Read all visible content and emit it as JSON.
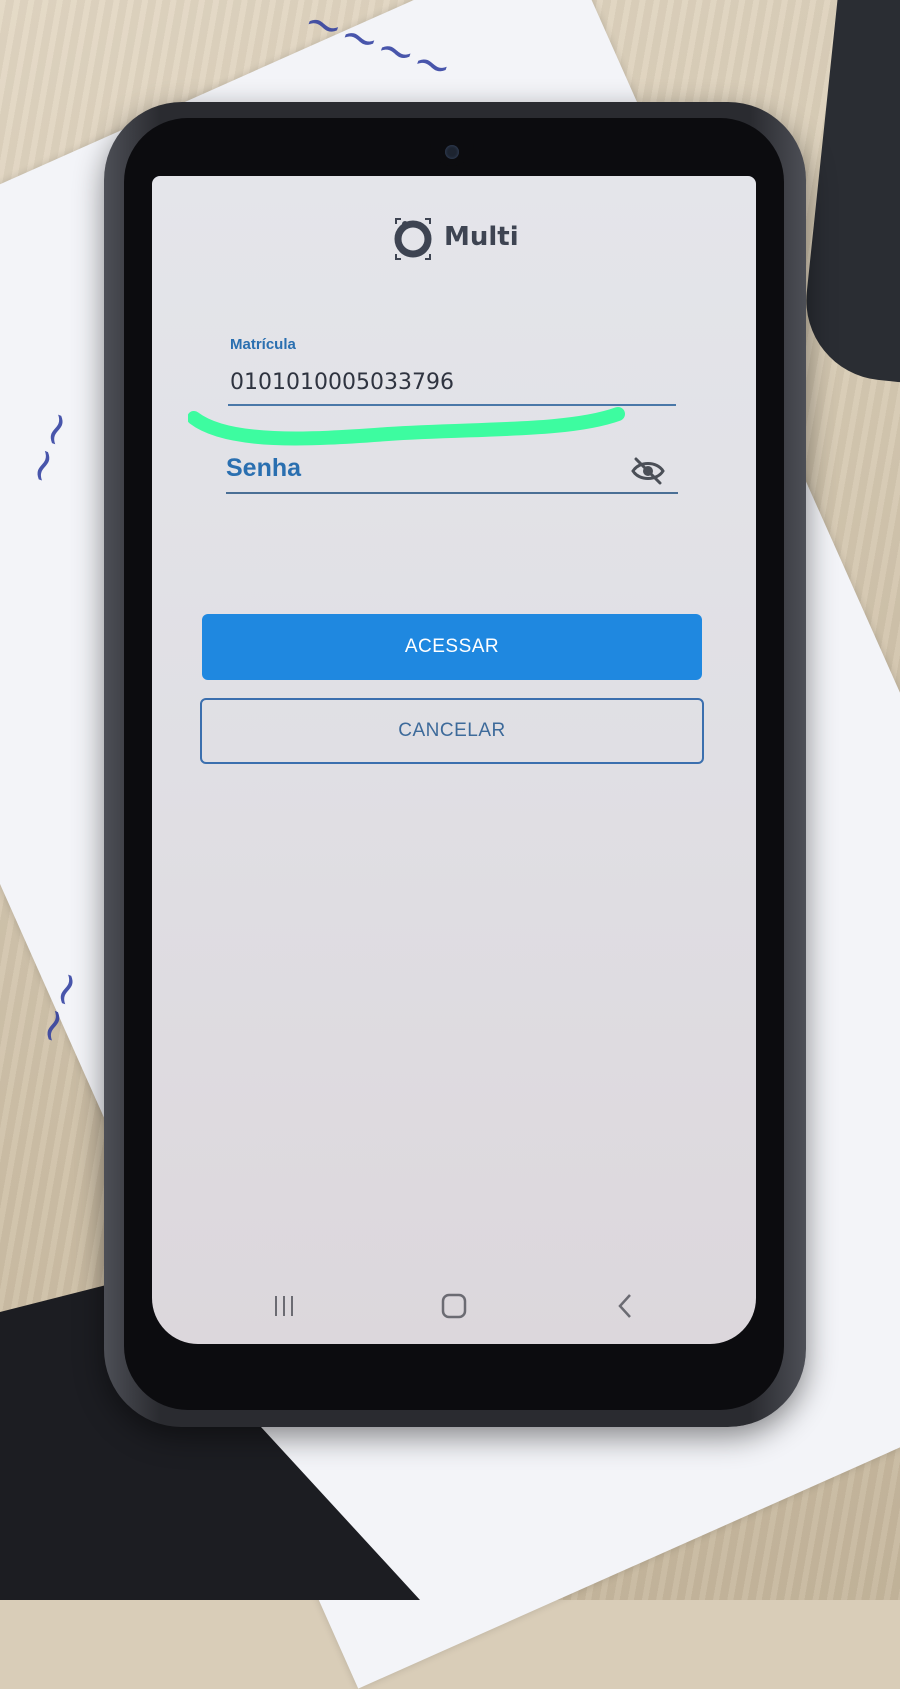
{
  "app": {
    "logo_name": "Multi",
    "logo_icon": "multi-logo-icon"
  },
  "login_form": {
    "matricula_label": "Matrícula",
    "matricula_value": "0101010005033796",
    "senha_placeholder": "Senha",
    "toggle_visibility_icon": "eye-off-icon"
  },
  "actions": {
    "access_label": "ACESSAR",
    "cancel_label": "CANCELAR"
  },
  "system_nav": {
    "recents_icon": "recents-icon",
    "home_icon": "home-icon",
    "back_icon": "back-icon"
  },
  "colors": {
    "accent_blue": "#1f88e0",
    "label_blue": "#2a6fb0",
    "highlight_green": "#3dfca0"
  }
}
